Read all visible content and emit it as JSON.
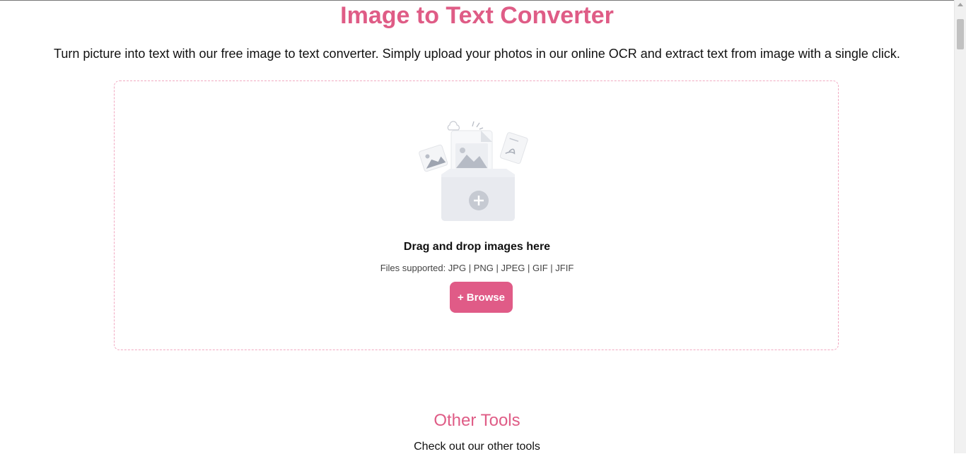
{
  "header": {
    "title": "Image to Text Converter",
    "subtitle": "Turn picture into text with our free image to text converter. Simply upload your photos in our online OCR and extract text from image with a single click."
  },
  "dropzone": {
    "illustration": "upload-folder-illustration",
    "title": "Drag and drop images here",
    "files_supported": "Files supported: JPG | PNG | JPEG | GIF | JFIF",
    "browse_icon": "+",
    "browse_label": "Browse"
  },
  "other_tools": {
    "title": "Other Tools",
    "subtitle": "Check out our other tools"
  },
  "colors": {
    "accent": "#df5c86",
    "button": "#e05b87",
    "dropzone_border": "#f1a9c1"
  }
}
